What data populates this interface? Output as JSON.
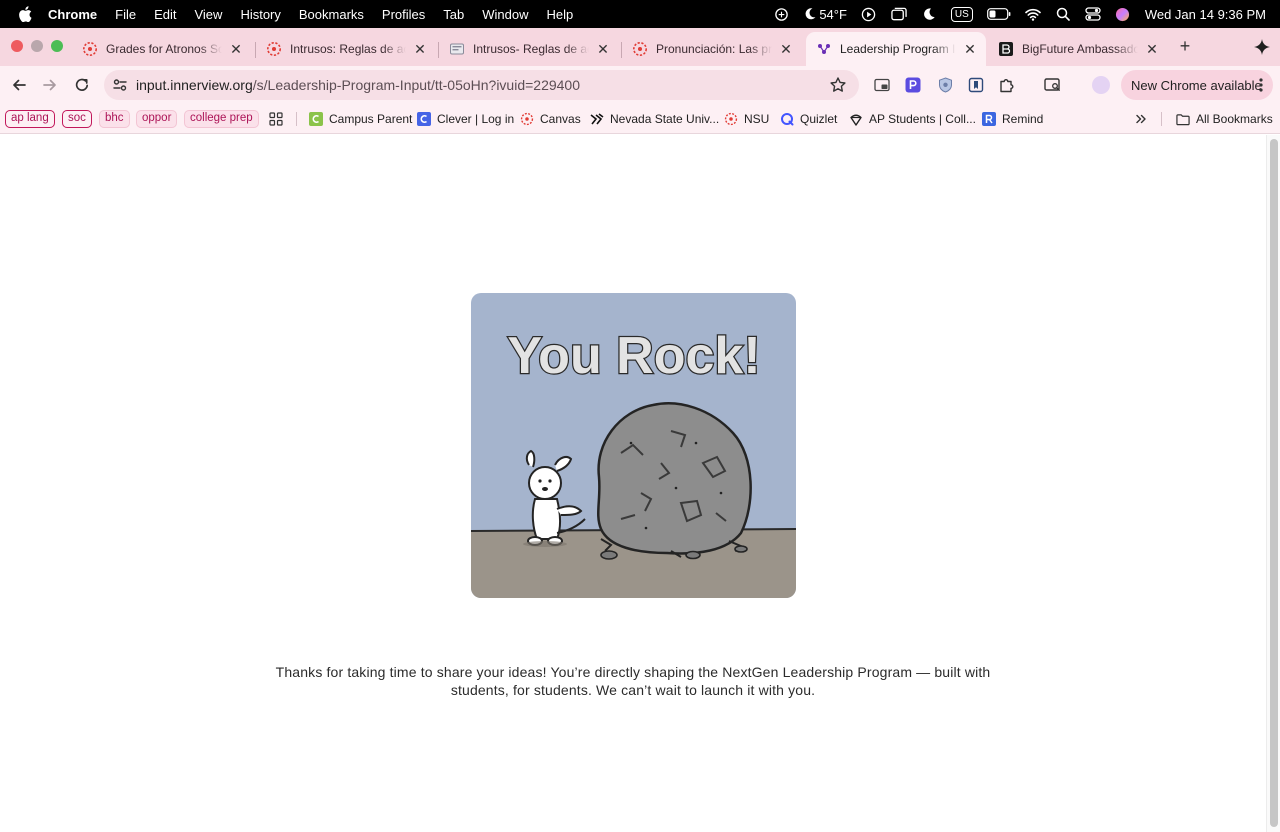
{
  "menubar": {
    "app": "Chrome",
    "items": [
      "File",
      "Edit",
      "View",
      "History",
      "Bookmarks",
      "Profiles",
      "Tab",
      "Window",
      "Help"
    ],
    "weather": "54°F",
    "input_source": "US",
    "datetime": "Wed Jan 14  9:36 PM"
  },
  "tabs": [
    {
      "title": "Grades for Atronos Solon",
      "favicon": "canvas-icon"
    },
    {
      "title": "Intrusos: Reglas de acentuación",
      "favicon": "canvas-icon"
    },
    {
      "title": "Intrusos- Reglas de acentuación",
      "favicon": "doc-icon"
    },
    {
      "title": "Pronunciación: Las preposiciones",
      "favicon": "canvas-icon"
    },
    {
      "title": "Leadership Program Input",
      "favicon": "innerview-icon",
      "active": true
    },
    {
      "title": "BigFuture Ambassador Program",
      "favicon": "bigfuture-icon"
    }
  ],
  "toolbar": {
    "url_host": "input.innerview.org",
    "url_path": "/s/Leadership-Program-Input/tt-05oHn?ivuid=229400",
    "update_label": "New Chrome available"
  },
  "bookmarks": {
    "groups": [
      "ap lang",
      "soc",
      "bhc",
      "oppor",
      "college prep"
    ],
    "items": [
      "Campus Parent",
      "Clever | Log in",
      "Canvas",
      "Nevada State Univ...",
      "NSU",
      "Quizlet",
      "AP Students | Coll...",
      "Remind"
    ],
    "all_label": "All Bookmarks"
  },
  "page": {
    "hero_text": "You Rock!",
    "message": "Thanks for taking  time to share your ideas! You’re directly shaping the NextGen Leadership Program — built with students, for students. We can’t wait to launch it with you."
  },
  "colors": {
    "tab_strip": "#f6d7e0",
    "toolbar": "#fdf0f4",
    "hero_sky": "#a5b4cd",
    "hero_ground": "#9b948a"
  }
}
